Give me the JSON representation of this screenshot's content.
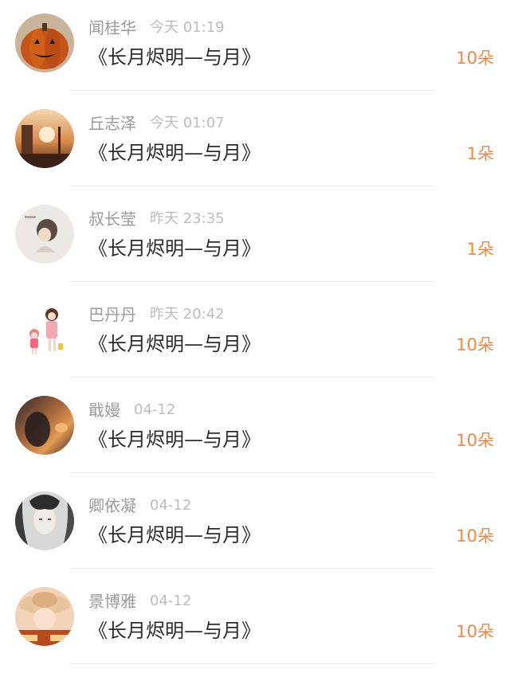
{
  "feed": {
    "items": [
      {
        "name": "闻桂华",
        "time": "今天 01:19",
        "title": "《长月烬明—与月》",
        "count": "10朵",
        "avatar_icon": "pumpkin-avatar"
      },
      {
        "name": "丘志泽",
        "time": "今天 01:07",
        "title": "《长月烬明—与月》",
        "count": "1朵",
        "avatar_icon": "sunset-street-avatar"
      },
      {
        "name": "叔长莹",
        "time": "昨天 23:35",
        "title": "《长月烬明—与月》",
        "count": "1朵",
        "avatar_icon": "sketch-girl-avatar"
      },
      {
        "name": "巴丹丹",
        "time": "昨天 20:42",
        "title": "《长月烬明—与月》",
        "count": "10朵",
        "avatar_icon": "cartoon-girls-avatar"
      },
      {
        "name": "戢嫚",
        "time": "04-12",
        "title": "《长月烬明—与月》",
        "count": "10朵",
        "avatar_icon": "sunset-portrait-avatar"
      },
      {
        "name": "卿依凝",
        "time": "04-12",
        "title": "《长月烬明—与月》",
        "count": "10朵",
        "avatar_icon": "ink-portrait-avatar"
      },
      {
        "name": "景博雅",
        "time": "04-12",
        "title": "《长月烬明—与月》",
        "count": "10朵",
        "avatar_icon": "hat-girl-avatar"
      }
    ]
  },
  "colors": {
    "count": "#f08a3c",
    "name": "#9a9a9a",
    "time": "#bdbdbd",
    "title": "#2c2c2c",
    "divider": "#efefef"
  }
}
